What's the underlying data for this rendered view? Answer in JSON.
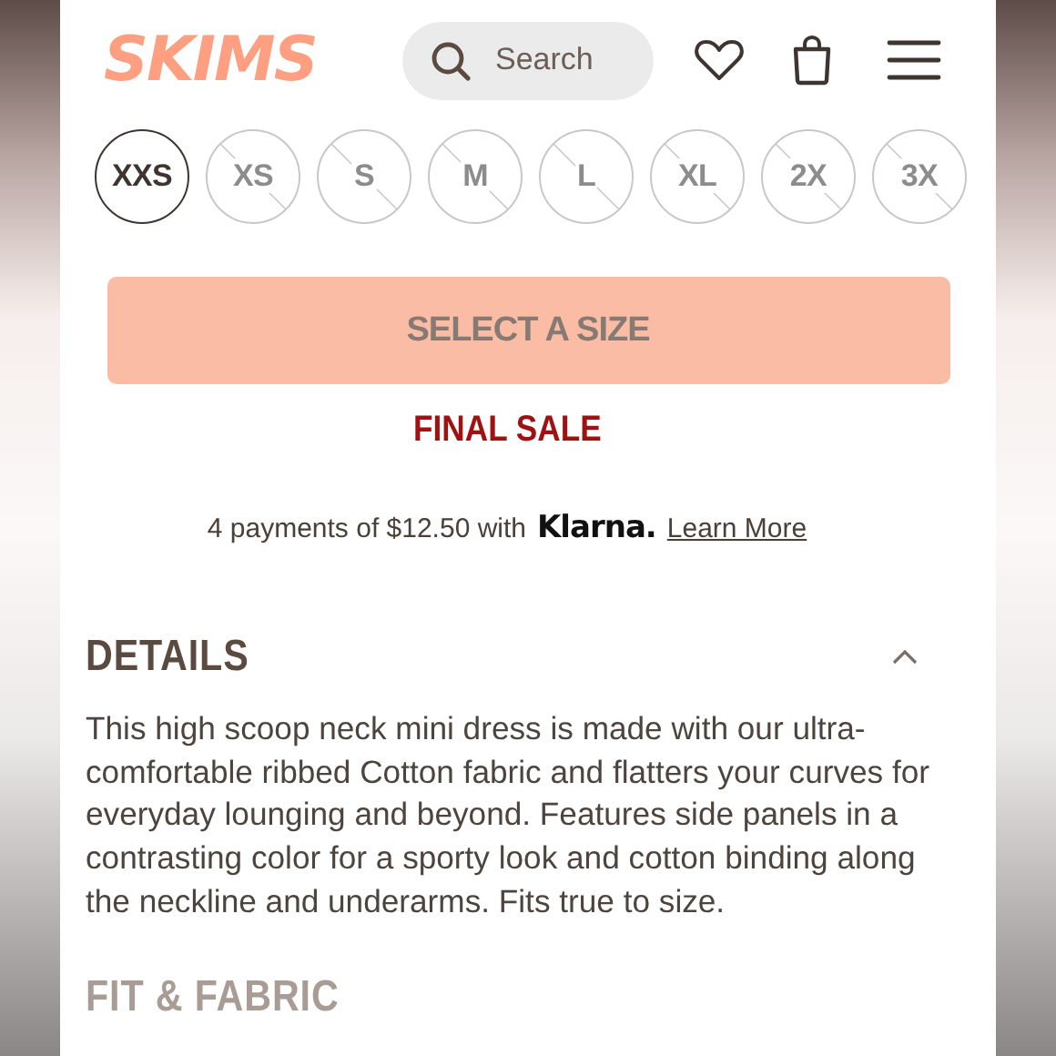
{
  "header": {
    "logo": "SKIMS",
    "search": {
      "placeholder": "Search"
    }
  },
  "sizes": [
    {
      "label": "XXS",
      "selected": true,
      "available": true
    },
    {
      "label": "XS",
      "selected": false,
      "available": false
    },
    {
      "label": "S",
      "selected": false,
      "available": false
    },
    {
      "label": "M",
      "selected": false,
      "available": false
    },
    {
      "label": "L",
      "selected": false,
      "available": false
    },
    {
      "label": "XL",
      "selected": false,
      "available": false
    },
    {
      "label": "2X",
      "selected": false,
      "available": false
    },
    {
      "label": "3X",
      "selected": false,
      "available": false
    }
  ],
  "add_button": {
    "label": "SELECT A SIZE",
    "disabled": true
  },
  "sale_notice": "FINAL SALE",
  "payments": {
    "text": "4 payments of $12.50 with",
    "provider": "Klarna.",
    "link": "Learn More"
  },
  "sections": [
    {
      "title": "DETAILS",
      "expanded": true,
      "body": "This high scoop neck mini dress is made with our ultra-comfortable ribbed Cotton fabric and flatters your curves for everyday lounging and beyond. Features side panels in a contrasting color for a sporty look and cotton binding along the neckline and underarms. Fits true to size."
    },
    {
      "title": "FIT & FABRIC",
      "expanded": false
    }
  ]
}
